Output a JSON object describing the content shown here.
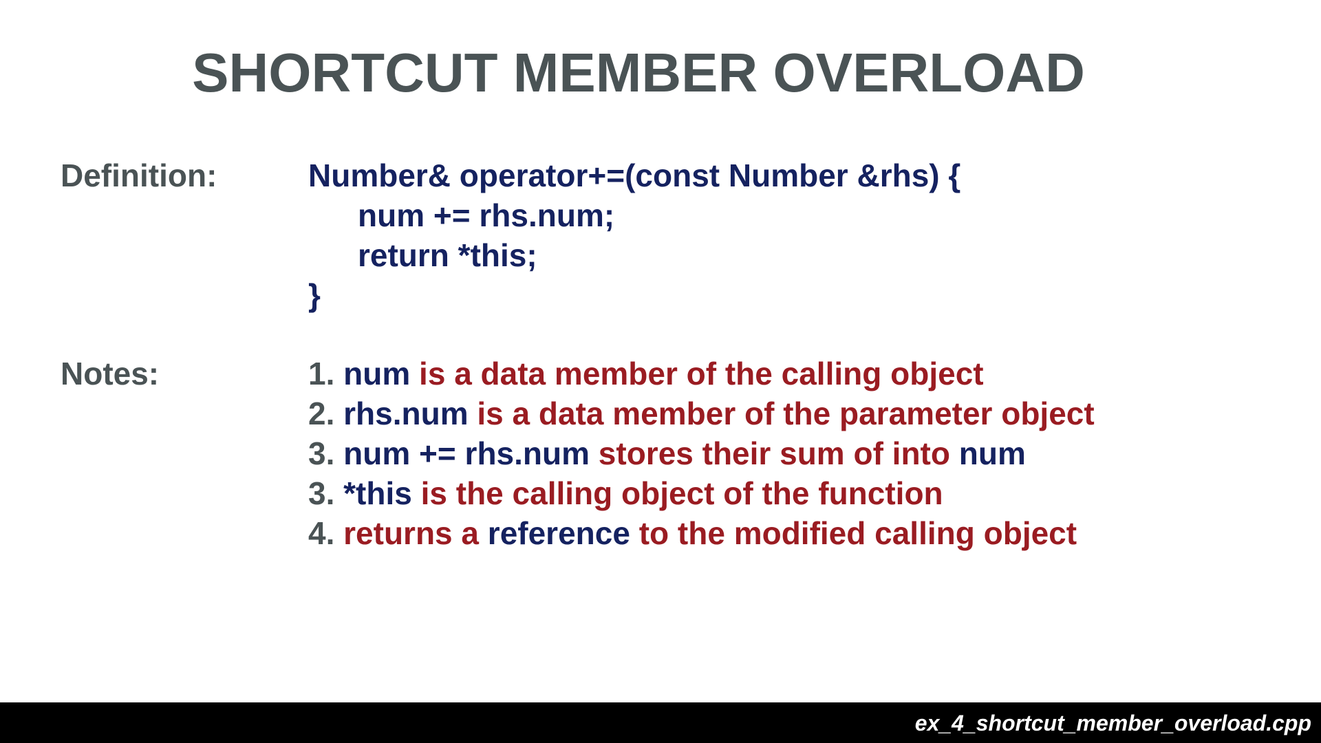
{
  "title": "SHORTCUT MEMBER OVERLOAD",
  "definition": {
    "label": "Definition:",
    "code_lines": [
      "Number& operator+=(const Number &rhs) {",
      "num += rhs.num;",
      "return *this;",
      "}"
    ]
  },
  "notes": {
    "label": "Notes:",
    "items": [
      {
        "number": "1.",
        "segments": [
          {
            "text": "num",
            "style": "code"
          },
          {
            "text": " is a data member of the calling object",
            "style": "text"
          }
        ]
      },
      {
        "number": "2.",
        "segments": [
          {
            "text": "rhs.num",
            "style": "code"
          },
          {
            "text": " is a data member of the parameter object",
            "style": "text"
          }
        ]
      },
      {
        "number": "3.",
        "segments": [
          {
            "text": "num += rhs.num",
            "style": "code"
          },
          {
            "text": " stores their sum of into ",
            "style": "text"
          },
          {
            "text": "num",
            "style": "code"
          }
        ]
      },
      {
        "number": "3.",
        "segments": [
          {
            "text": "*this",
            "style": "code"
          },
          {
            "text": " is the calling object of the function",
            "style": "text"
          }
        ]
      },
      {
        "number": "4.",
        "segments": [
          {
            "text": "returns a ",
            "style": "text"
          },
          {
            "text": "reference",
            "style": "code"
          },
          {
            "text": " to the modified calling object",
            "style": "text"
          }
        ]
      }
    ]
  },
  "footer": {
    "filename": "ex_4_shortcut_member_overload.cpp"
  },
  "colors": {
    "title_gray": "#4a5355",
    "code_navy": "#152260",
    "text_red": "#9a1c22",
    "footer_bg": "#000000"
  }
}
